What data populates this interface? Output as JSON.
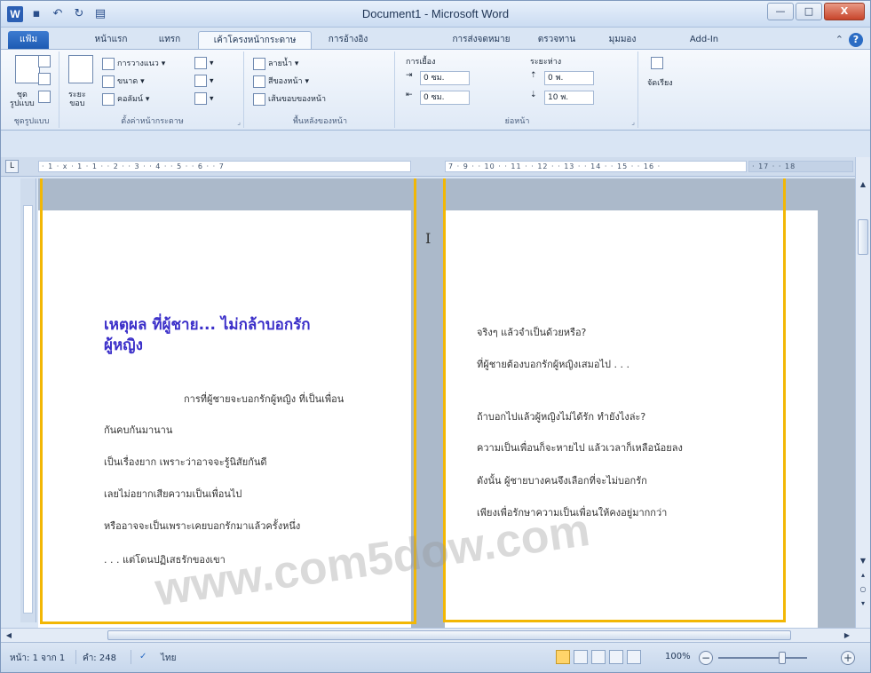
{
  "window": {
    "title": "Document1 - Microsoft Word",
    "app_icon": "W",
    "controls": {
      "minimize": "—",
      "maximize": "□",
      "close": "X"
    }
  },
  "quick_access": [
    {
      "icon": "save-icon",
      "glyph": "▪"
    },
    {
      "icon": "undo-icon",
      "glyph": "↶"
    },
    {
      "icon": "redo-icon",
      "glyph": "↻"
    },
    {
      "icon": "print-icon",
      "glyph": "▤"
    }
  ],
  "tabs": [
    {
      "label": "แฟ้ม",
      "kind": "file"
    },
    {
      "label": "หน้าแรก"
    },
    {
      "label": "แทรก"
    },
    {
      "label": "เค้าโครงหน้ากระดาษ",
      "active": true
    },
    {
      "label": "การอ้างอิง"
    },
    {
      "label": "การส่งจดหมาย"
    },
    {
      "label": "ตรวจทาน"
    },
    {
      "label": "มุมมอง"
    },
    {
      "label": "Add-In"
    }
  ],
  "ribbon": {
    "themes": {
      "big_label": "ชุด\nรูปแบบ",
      "label": "ชุดรูปแบบ"
    },
    "page_setup": {
      "margins": "ระยะ\nขอบ",
      "orientation": "การวางแนว",
      "size": "ขนาด",
      "columns": "คอลัมน์",
      "label": "ตั้งค่าหน้ากระดาษ"
    },
    "page_background": {
      "watermark": "ลายน้ำ",
      "page_color": "สีของหน้า",
      "page_borders": "เส้นขอบของหน้า",
      "label": "พื้นหลังของหน้า"
    },
    "paragraph": {
      "indent_title": "การเยื้อง",
      "indent_left": "0 ซม.",
      "indent_right": "0 ซม.",
      "spacing_title": "ระยะห่าง",
      "spacing_before": "0 พ.",
      "spacing_after": "10 พ.",
      "label": "ย่อหน้า"
    },
    "arrange": {
      "label": "จัดเรียง"
    }
  },
  "ruler": {
    "left": "· 1 · ⅹ · 1 · 1 · · 2 · · 3 · · 4 · · 5 · · 6 · · 7",
    "right": "7 · 9 · · 10 · · 11 · · 12 · · 13 · · 14 · · 15 · · 16 ·",
    "tail": "· 17 · · 18"
  },
  "page1": {
    "heading_line1": "เหตุผล ที่ผู้ชาย... ไม่กล้าบอกรัก",
    "heading_line2": "ผู้หญิง",
    "lines": [
      "การที่ผู้ชายจะบอกรักผู้หญิง ที่เป็นเพื่อน",
      "กันคบกันมานาน",
      "เป็นเรื่องยาก เพราะว่าอาจจะรู้นิสัยกันดี",
      "เลยไม่อยากเสียความเป็นเพื่อนไป",
      "หรืออาจจะเป็นเพราะเคยบอกรักมาแล้วครั้งหนึ่ง",
      ". . . แต่โดนปฏิเสธรักของเขา"
    ]
  },
  "page2": {
    "lines": [
      "จริงๆ แล้วจำเป็นด้วยหรือ?",
      "ที่ผู้ชายต้องบอกรักผู้หญิงเสมอไป . . .",
      "ถ้าบอกไปแล้วผู้หญิงไม่ได้รัก ทำยังไงล่ะ?",
      "ความเป็นเพื่อนก็จะหายไป แล้วเวลาก็เหลือน้อยลง",
      "ดังนั้น ผู้ชายบางคนจึงเลือกที่จะไม่บอกรัก",
      "เพียงเพื่อรักษาความเป็นเพื่อนให้คงอยู่มากกว่า"
    ]
  },
  "watermark": "www.com5dow.com",
  "status": {
    "page": "หน้า: 1 จาก 1",
    "words": "คำ: 248",
    "language": "ไทย",
    "zoom": "100%"
  },
  "colors": {
    "heading": "#3b2fc9",
    "highlight_frame": "#f2b705",
    "file_tab": "#2b5fb4"
  }
}
